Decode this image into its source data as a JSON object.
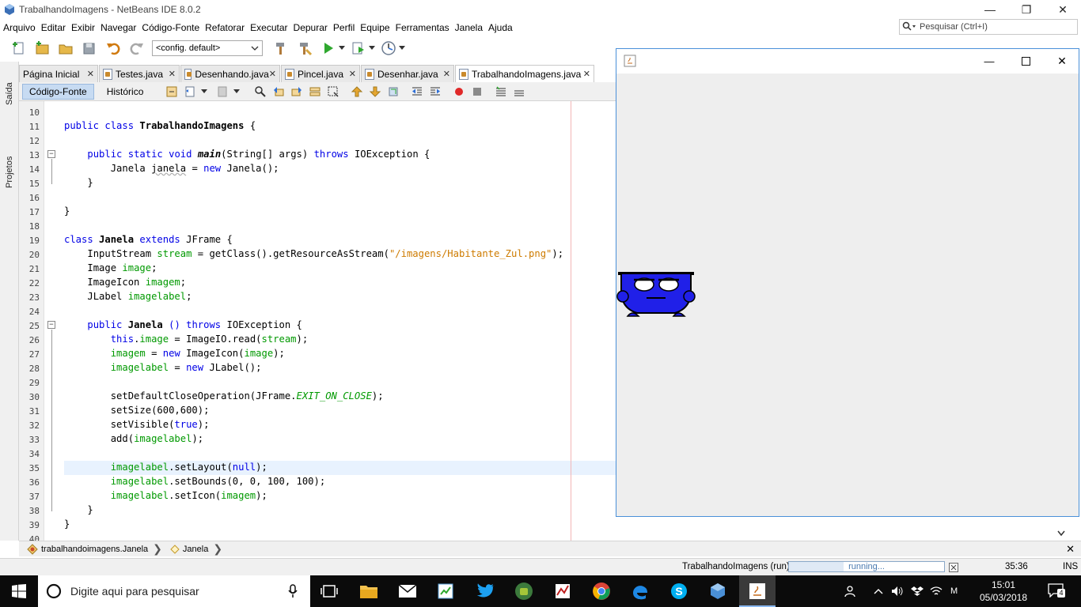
{
  "window": {
    "title": "TrabalhandoImagens - NetBeans IDE 8.0.2"
  },
  "menu": [
    "Arquivo",
    "Editar",
    "Exibir",
    "Navegar",
    "Código-Fonte",
    "Refatorar",
    "Executar",
    "Depurar",
    "Perfil",
    "Equipe",
    "Ferramentas",
    "Janela",
    "Ajuda"
  ],
  "search": {
    "placeholder": "Pesquisar (Ctrl+I)"
  },
  "toolbar": {
    "config_value": "<config. default>"
  },
  "side_tabs": [
    "Saída",
    "Projetos"
  ],
  "tabs": [
    {
      "label": "Página Inicial",
      "active": false
    },
    {
      "label": "Testes.java",
      "active": false
    },
    {
      "label": "Desenhando.java",
      "active": false
    },
    {
      "label": "Pincel.java",
      "active": false
    },
    {
      "label": "Desenhar.java",
      "active": false
    },
    {
      "label": "TrabalhandoImagens.java",
      "active": true
    }
  ],
  "source_tabs": [
    "Código-Fonte",
    "Histórico"
  ],
  "editor": {
    "line_numbers": [
      "10",
      "11",
      "12",
      "13",
      "14",
      "15",
      "16",
      "17",
      "18",
      "19",
      "20",
      "21",
      "22",
      "23",
      "24",
      "25",
      "26",
      "27",
      "28",
      "29",
      "30",
      "31",
      "32",
      "33",
      "34",
      "35",
      "36",
      "37",
      "38",
      "39",
      "40"
    ],
    "current_line": "35"
  },
  "breadcrumb": [
    "trabalhandoimagens.Janela",
    "Janela"
  ],
  "status": {
    "task": "TrabalhandoImagens (run)",
    "progress_text": "running...",
    "progress_fraction": 0.35,
    "position": "35:36",
    "mode": "INS"
  },
  "taskbar": {
    "search_placeholder": "Digite aqui para pesquisar",
    "time": "15:01",
    "date": "05/03/2018",
    "notification_count": "4"
  },
  "colors": {
    "keyword": "#0000e6",
    "field": "#009900",
    "string": "#ce7b00",
    "sprite": "#2020e8"
  }
}
